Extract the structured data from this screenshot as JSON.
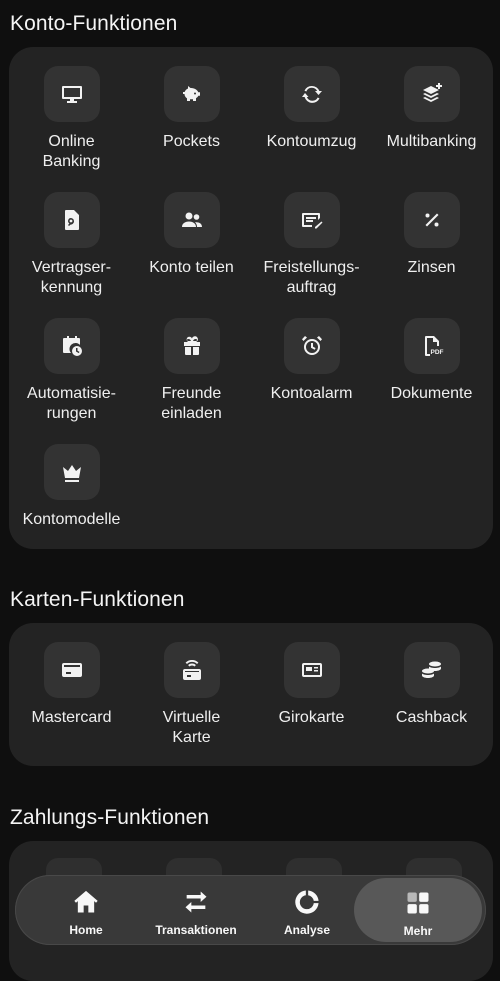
{
  "sections": [
    {
      "title": "Konto-Funktionen",
      "items": [
        {
          "label": "Online\nBanking",
          "icon": "monitor-icon"
        },
        {
          "label": "Pockets",
          "icon": "piggy-bank-icon"
        },
        {
          "label": "Kontoumzug",
          "icon": "refresh-icon"
        },
        {
          "label": "Multibanking",
          "icon": "layers-plus-icon"
        },
        {
          "label": "Vertragser-\nkennung",
          "icon": "document-search-icon"
        },
        {
          "label": "Konto teilen",
          "icon": "users-icon"
        },
        {
          "label": "Freistellungs-\nauftrag",
          "icon": "form-edit-icon"
        },
        {
          "label": "Zinsen",
          "icon": "percent-icon"
        },
        {
          "label": "Automatisie-\nrungen",
          "icon": "calendar-clock-icon"
        },
        {
          "label": "Freunde\neinladen",
          "icon": "gift-icon"
        },
        {
          "label": "Kontoalarm",
          "icon": "alarm-clock-icon"
        },
        {
          "label": "Dokumente",
          "icon": "pdf-icon"
        },
        {
          "label": "Kontomodelle",
          "icon": "crown-icon"
        }
      ]
    },
    {
      "title": "Karten-Funktionen",
      "items": [
        {
          "label": "Mastercard",
          "icon": "credit-card-icon"
        },
        {
          "label": "Virtuelle\nKarte",
          "icon": "virtual-card-icon"
        },
        {
          "label": "Girokarte",
          "icon": "giro-card-icon"
        },
        {
          "label": "Cashback",
          "icon": "coins-icon"
        }
      ]
    },
    {
      "title": "Zahlungs-Funktionen",
      "items": []
    }
  ],
  "nav": [
    {
      "label": "Home",
      "icon": "home-icon",
      "active": false
    },
    {
      "label": "Transaktionen",
      "icon": "transfer-arrows-icon",
      "active": false
    },
    {
      "label": "Analyse",
      "icon": "donut-chart-icon",
      "active": false
    },
    {
      "label": "Mehr",
      "icon": "grid-icon",
      "active": true
    }
  ]
}
